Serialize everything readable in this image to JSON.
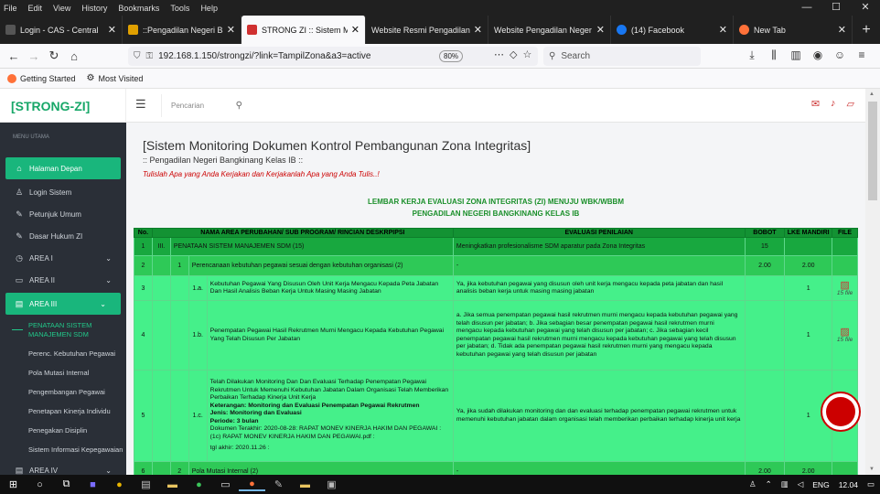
{
  "menubar": {
    "items": [
      "File",
      "Edit",
      "View",
      "History",
      "Bookmarks",
      "Tools",
      "Help"
    ]
  },
  "window_controls": {
    "minimize": "—",
    "maximize": "☐",
    "close": "✕"
  },
  "tabs": [
    {
      "title": "Login - CAS - Central",
      "favicon_color": "#555555",
      "active": false
    },
    {
      "title": "::Pengadilan Negeri Ba",
      "favicon_color": "#e0a000",
      "active": false
    },
    {
      "title": "STRONG ZI :: Sistem M",
      "favicon_color": "#d03030",
      "active": true
    },
    {
      "title": "Website Resmi Pengadilan",
      "favicon_color": "",
      "active": false
    },
    {
      "title": "Website Pengadilan Neger",
      "favicon_color": "",
      "active": false
    },
    {
      "title": "(14) Facebook",
      "favicon_color": "#1877f2",
      "active": false
    },
    {
      "title": "New Tab",
      "favicon_color": "#ff7139",
      "active": false
    }
  ],
  "navbar": {
    "url": "192.168.1.150/strongzi/?link=TampilZona&a3=active",
    "zoom": "80%",
    "search_placeholder": "Search"
  },
  "bookmarks": [
    {
      "label": "Getting Started",
      "icon": "firefox-icon"
    },
    {
      "label": "Most Visited",
      "icon": "gear-icon"
    }
  ],
  "app": {
    "logo": "[STRONG-ZI]",
    "search_placeholder": "Pencarian"
  },
  "sidebar": {
    "heading": "MENU UTAMA",
    "items": [
      {
        "label": "Halaman Depan",
        "icon": "⌂",
        "state": "active"
      },
      {
        "label": "Login Sistem",
        "icon": "♙",
        "state": ""
      },
      {
        "label": "Petunjuk Umum",
        "icon": "✎",
        "state": ""
      },
      {
        "label": "Dasar Hukum ZI",
        "icon": "✎",
        "state": ""
      },
      {
        "label": "AREA I",
        "icon": "◷",
        "state": "collapsed"
      },
      {
        "label": "AREA II",
        "icon": "▭",
        "state": "collapsed"
      },
      {
        "label": "AREA III",
        "icon": "▤",
        "state": "open"
      }
    ],
    "sub_items": [
      {
        "label": "PENATAAN SISTEM MANAJEMEN SDM",
        "current": true
      },
      {
        "label": "Perenc. Kebutuhan Pegawai",
        "current": false
      },
      {
        "label": "Pola Mutasi Internal",
        "current": false
      },
      {
        "label": "Pengembangan Pegawai",
        "current": false
      },
      {
        "label": "Penetapan Kinerja Individu",
        "current": false
      },
      {
        "label": "Penegakan Disiplin",
        "current": false
      },
      {
        "label": "Sistem Informasi Kepegawaian",
        "current": false
      }
    ],
    "trailing": {
      "label": "AREA IV",
      "icon": "▤"
    }
  },
  "page": {
    "title": "[Sistem Monitoring Dokumen Kontrol Pembangunan Zona Integritas]",
    "subtitle": ":: Pengadilan Negeri Bangkinang Kelas IB ::",
    "motto": "Tulislah Apa yang Anda Kerjakan dan Kerjakanlah Apa yang Anda Tulis..!",
    "sheet_title": "LEMBAR KERJA EVALUASI ZONA INTEGRITAS (ZI) MENUJU WBK/WBBM",
    "sheet_org": "PENGADILAN NEGERI BANGKINANG KELAS IB"
  },
  "table": {
    "headers": {
      "no": "No.",
      "area": "NAMA AREA PERUBAHAN/ SUB PROGRAM/ RINCIAN DESKRPIPSI",
      "eval": "EVALUASI PENILAIAN",
      "bobot": "BOBOT",
      "lke": "LKE MANDIRI",
      "file": "FILE"
    },
    "rows": [
      {
        "type": "area",
        "no": "1",
        "a": "III.",
        "name": "PENATAAN SISTEM MANAJEMEN SDM (15)",
        "eval": "Meningkatkan profesionalisme SDM aparatur pada Zona Integritas",
        "bobot": "15",
        "lke": ""
      },
      {
        "type": "prog",
        "no": "2",
        "b": "1",
        "name": "Perencanaan kebutuhan pegawai sesuai dengan kebutuhan organisasi (2)",
        "eval": "-",
        "bobot": "2.00",
        "lke": "2.00"
      },
      {
        "type": "item",
        "no": "3",
        "c": "1.a.",
        "name": "Kebutuhan Pegawai Yang Disusun Oleh Unit Kerja Mengacu Kepada Peta Jabatan Dan Hasil Analisis Beban Kerja Untuk Masing Masing Jabatan",
        "eval": "Ya, jika kebutuhan pegawai yang disusun oleh unit kerja mengacu kepada peta jabatan dan hasil analisis beban kerja untuk masing masing jabatan",
        "lke": "1",
        "file_count": "15 file"
      },
      {
        "type": "item",
        "no": "4",
        "c": "1.b.",
        "name": "Penempatan Pegawai Hasil Rekrutmen Murni Mengacu Kepada Kebutuhan Pegawai Yang Telah Disusun Per Jabatan",
        "eval": "a. Jika semua penempatan pegawai hasil rekrutmen murni mengacu kepada kebutuhan pegawai yang telah disusun per jabatan; b. Jika sebagian besar penempatan pegawai hasil rekrutmen murni mengacu kepada kebutuhan pegawai yang telah disusun per jabatan; c. Jika sebagian kecil penempatan pegawai hasil rekrutmen murni mengacu kepada kebutuhan pegawai yang telah disusun per jabatan; d. Tidak ada penempatan pegawai hasil rekrutmen murni yang mengacu kepada kebutuhan pegawai yang telah disusun per jabatan",
        "lke": "1",
        "file_count": "15 file"
      },
      {
        "type": "item",
        "no": "5",
        "c": "1.c.",
        "name": "Telah Dilakukan Monitoring Dan Dan Evaluasi Terhadap Penempatan Pegawai Rekrutmen Untuk Memenuhi Kebutuhan Jabatan Dalam Organisasi Telah Memberikan Perbaikan Terhadap Kinerja Unit Kerja",
        "keterangan": "Keterangan: Monitoring dan Evaluasi Penempatan Pegawai Rekrutmen",
        "jenis": "Jenis: Monitoring dan Evaluasi",
        "periode": "Periode: 3 bulan",
        "doc": "Dokumen Terakhir: 2020-08-28: RAPAT MONEV KINERJA HAKIM DAN PEGAWAI : (1c) RAPAT MONEV KINERJA HAKIM DAN PEGAWAI.pdf :",
        "tgl": "tgl akhir: 2020.11.26 :",
        "eval": "Ya, jika sudah dilakukan monitoring dan dan evaluasi terhadap penempatan pegawai rekrutmen untuk memenuhi kebutuhan jabatan dalam organisasi telah memberikan perbaikan terhadap kinerja unit kerja",
        "lke": "1"
      },
      {
        "type": "prog",
        "no": "6",
        "b": "2",
        "name": "Pola Mutasi Internal (2)",
        "eval": "-",
        "bobot": "2.00",
        "lke": "2.00"
      }
    ]
  },
  "taskbar": {
    "lang": "ENG",
    "time": "12.04"
  }
}
